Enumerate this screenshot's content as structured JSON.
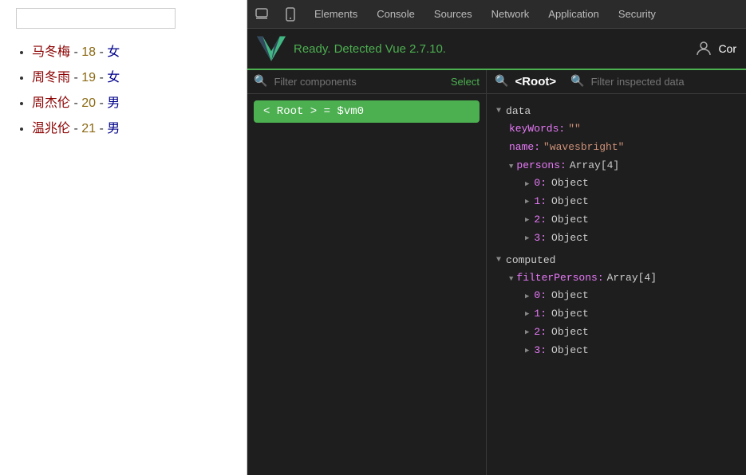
{
  "left": {
    "persons": [
      {
        "name": "马冬梅",
        "age": "18",
        "gender": "女"
      },
      {
        "name": "周冬雨",
        "age": "19",
        "gender": "女"
      },
      {
        "name": "周杰伦",
        "age": "20",
        "gender": "男"
      },
      {
        "name": "温兆伦",
        "age": "21",
        "gender": "男"
      }
    ]
  },
  "devtools": {
    "tabs": [
      "Elements",
      "Console",
      "Sources",
      "Network",
      "Application",
      "Security"
    ],
    "vue_status": "Ready. Detected Vue 2.7.10.",
    "cor_label": "Cor",
    "component_search_placeholder": "Filter components",
    "select_label": "Select",
    "root_item_label": "< Root > = $vm0",
    "breadcrumb": "<Root>",
    "filter_placeholder": "Filter inspected data",
    "data_section": "data",
    "keywords_key": "keyWords:",
    "keywords_value": "\"\"",
    "name_key": "name:",
    "name_value": "\"wavesbright\"",
    "persons_key": "persons:",
    "persons_value": "Array[4]",
    "persons_items": [
      {
        "index": "0",
        "label": "Object"
      },
      {
        "index": "1",
        "label": "Object"
      },
      {
        "index": "2",
        "label": "Object"
      },
      {
        "index": "3",
        "label": "Object"
      }
    ],
    "computed_section": "computed",
    "filter_persons_key": "filterPersons:",
    "filter_persons_value": "Array[4]",
    "filter_persons_items": [
      {
        "index": "0",
        "label": "Object"
      },
      {
        "index": "1",
        "label": "Object"
      },
      {
        "index": "2",
        "label": "Object"
      },
      {
        "index": "3",
        "label": "Object"
      }
    ]
  }
}
